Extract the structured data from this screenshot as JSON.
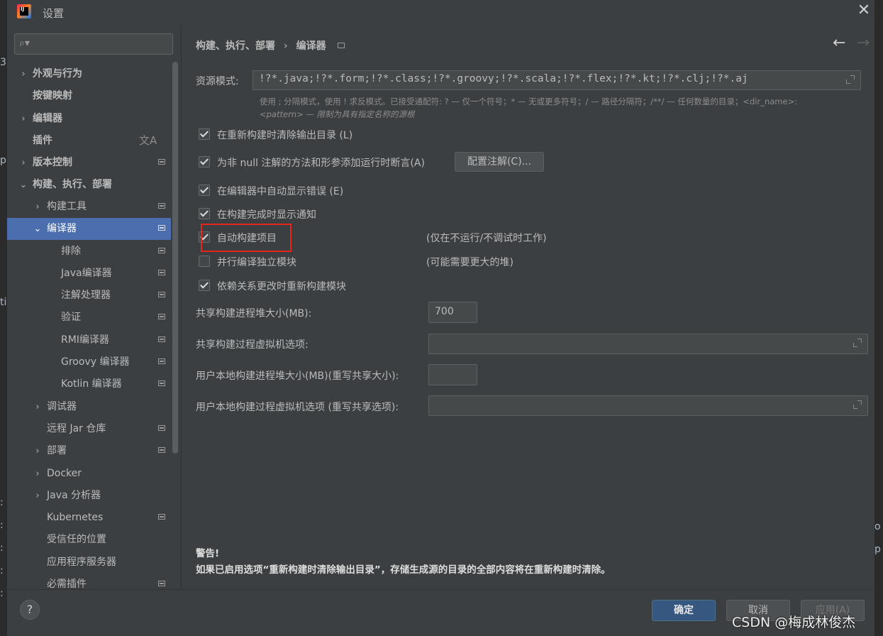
{
  "dialog": {
    "title": "设置"
  },
  "search": {
    "placeholder": ""
  },
  "sidebar": {
    "items": [
      {
        "label": "外观与行为",
        "arrow": "›",
        "expanded": false
      },
      {
        "label": "按键映射"
      },
      {
        "label": "编辑器",
        "arrow": "›",
        "expanded": false
      },
      {
        "label": "插件"
      },
      {
        "label": "版本控制",
        "arrow": "›",
        "expanded": false
      },
      {
        "label": "构建、执行、部署",
        "arrow": "⌄",
        "expanded": true
      },
      {
        "label": "构建工具",
        "arrow": "›"
      },
      {
        "label": "编译器",
        "arrow": "⌄",
        "selected": true
      },
      {
        "label": "排除"
      },
      {
        "label": "Java编译器"
      },
      {
        "label": "注解处理器"
      },
      {
        "label": "验证"
      },
      {
        "label": "RMI编译器"
      },
      {
        "label": "Groovy 编译器"
      },
      {
        "label": "Kotlin 编译器"
      },
      {
        "label": "调试器",
        "arrow": "›"
      },
      {
        "label": "远程 Jar 仓库"
      },
      {
        "label": "部署",
        "arrow": "›"
      },
      {
        "label": "Docker",
        "arrow": "›"
      },
      {
        "label": "Java 分析器",
        "arrow": "›"
      },
      {
        "label": "Kubernetes"
      },
      {
        "label": "受信任的位置"
      },
      {
        "label": "应用程序服务器"
      },
      {
        "label": "必需插件"
      }
    ],
    "translate_icon": "文A"
  },
  "breadcrumb": {
    "parent": "构建、执行、部署",
    "separator": "›",
    "current": "编译器"
  },
  "nav": {
    "back": "←",
    "forward": "→"
  },
  "compiler": {
    "resource_label": "资源模式:",
    "resource_value": "!?*.java;!?*.form;!?*.class;!?*.groovy;!?*.scala;!?*.flex;!?*.kt;!?*.clj;!?*.aj",
    "hint_line1": "使用 ; 分隔模式，使用 ! 求反模式。已接受通配符: ? — 仅一个符号；* — 无或更多符号；/ — 路径分隔符；/**/ — 任何数量的目录；<dir_name>:",
    "hint_line2": "<pattern> — 限制为具有指定名称的源根",
    "options": {
      "clear_output": {
        "label": "在重新构建时清除输出目录 (L)",
        "checked": true
      },
      "not_null": {
        "label": "为非 null 注解的方法和形参添加运行时断言(A)",
        "checked": true
      },
      "configure_annotations": "配置注解(C)...",
      "auto_show_errors": {
        "label": "在编辑器中自动显示错误 (E)",
        "checked": true
      },
      "notify_done": {
        "label": "在构建完成时显示通知",
        "checked": true
      },
      "auto_build": {
        "label": "自动构建项目",
        "checked": true,
        "note": "(仅在不运行/不调试时工作)"
      },
      "parallel": {
        "label": "并行编译独立模块",
        "checked": false,
        "note": "(可能需要更大的堆)"
      },
      "rebuild_deps": {
        "label": "依赖关系更改时重新构建模块",
        "checked": true
      }
    },
    "shared_heap_label": "共享构建进程堆大小(MB):",
    "shared_heap_value": "700",
    "shared_vm_label": "共享构建过程虚拟机选项:",
    "shared_vm_value": "",
    "local_heap_label": "用户本地构建进程堆大小(MB)(重写共享大小):",
    "local_heap_value": "",
    "local_vm_label": "用户本地构建过程虚拟机选项 (重写共享选项):",
    "local_vm_value": ""
  },
  "warning": {
    "title": "警告!",
    "body": "如果已启用选项“重新构建时清除输出目录”，存储生成源的目录的全部内容将在重新构建时清除。"
  },
  "footer": {
    "help": "?",
    "ok": "确定",
    "cancel": "取消",
    "apply": "应用(A)"
  },
  "watermark": "CSDN @梅成林俊杰",
  "colors": {
    "selection": "#4b6eaf",
    "highlight_box": "#e8251b",
    "ok_button": "#365880"
  }
}
